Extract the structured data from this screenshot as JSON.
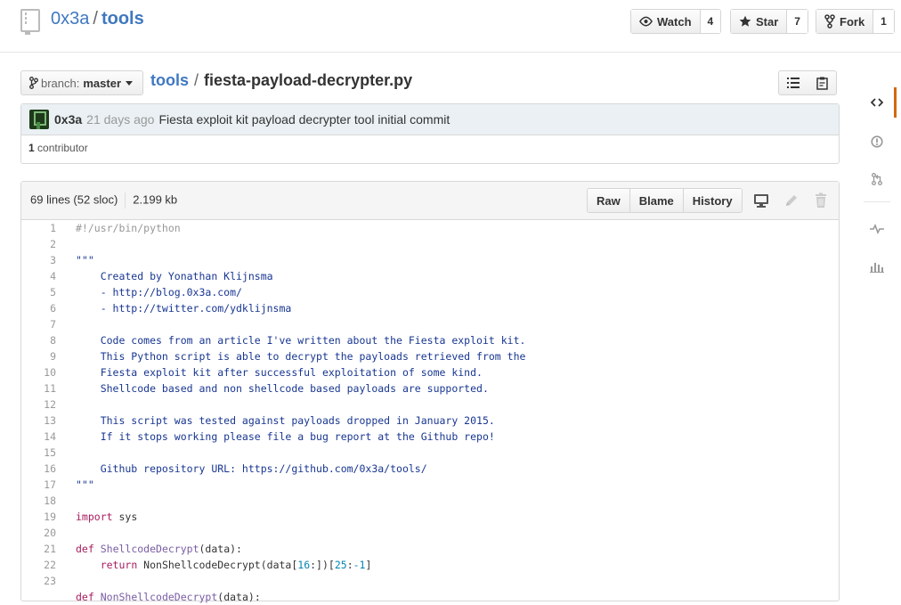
{
  "repo": {
    "owner": "0x3a",
    "separator": "/",
    "name": "tools"
  },
  "actions": {
    "watch": {
      "label": "Watch",
      "count": "4"
    },
    "star": {
      "label": "Star",
      "count": "7"
    },
    "fork": {
      "label": "Fork",
      "count": "1"
    }
  },
  "branch": {
    "label": "branch:",
    "value": "master"
  },
  "breadcrumb": {
    "root": "tools",
    "separator": "/",
    "file": "fiesta-payload-decrypter.py"
  },
  "commit": {
    "author": "0x3a",
    "time": "21 days ago",
    "message": "Fiesta exploit kit payload decrypter tool initial commit",
    "contributors_count": "1",
    "contributors_label": "contributor"
  },
  "file": {
    "lines_info": "69 lines (52 sloc)",
    "size": "2.199 kb",
    "buttons": {
      "raw": "Raw",
      "blame": "Blame",
      "history": "History"
    }
  },
  "code": {
    "line_numbers": [
      "1",
      "2",
      "3",
      "4",
      "5",
      "6",
      "7",
      "8",
      "9",
      "10",
      "11",
      "12",
      "13",
      "14",
      "15",
      "16",
      "17",
      "18",
      "19",
      "20",
      "21",
      "22",
      "23"
    ],
    "l1": "#!/usr/bin/python",
    "l3": "\"\"\"",
    "l4": "    Created by Yonathan Klijnsma",
    "l5": "    - http://blog.0x3a.com/",
    "l6": "    - http://twitter.com/ydklijnsma",
    "l8": "    Code comes from an article I've written about the Fiesta exploit kit.",
    "l9": "    This Python script is able to decrypt the payloads retrieved from the",
    "l10": "    Fiesta exploit kit after successful exploitation of some kind.",
    "l11": "    Shellcode based and non shellcode based payloads are supported.",
    "l13": "    This script was tested against payloads dropped in January 2015.",
    "l14": "    If it stops working please file a bug report at the Github repo!",
    "l16": "    Github repository URL: https://github.com/0x3a/tools/",
    "l17": "\"\"\"",
    "l19_kw": "import",
    "l19_rest": " sys",
    "l21_kw": "def",
    "l21_fn": "ShellcodeDecrypt",
    "l21_rest": "(data):",
    "l22_kw": "return",
    "l22_a": " NonShellcodeDecrypt(data[",
    "l22_n1": "16",
    "l22_b": ":])[",
    "l22_n2": "25",
    "l22_c": ":",
    "l22_n3": "-1",
    "l22_d": "]",
    "l24_kw": "def",
    "l24_fn": "NonShellcodeDecrypt",
    "l24_rest": "(data):"
  },
  "colors": {
    "link": "#4078c0",
    "active_tab": "#d26911",
    "string": "#183691",
    "keyword": "#a71d5d"
  }
}
